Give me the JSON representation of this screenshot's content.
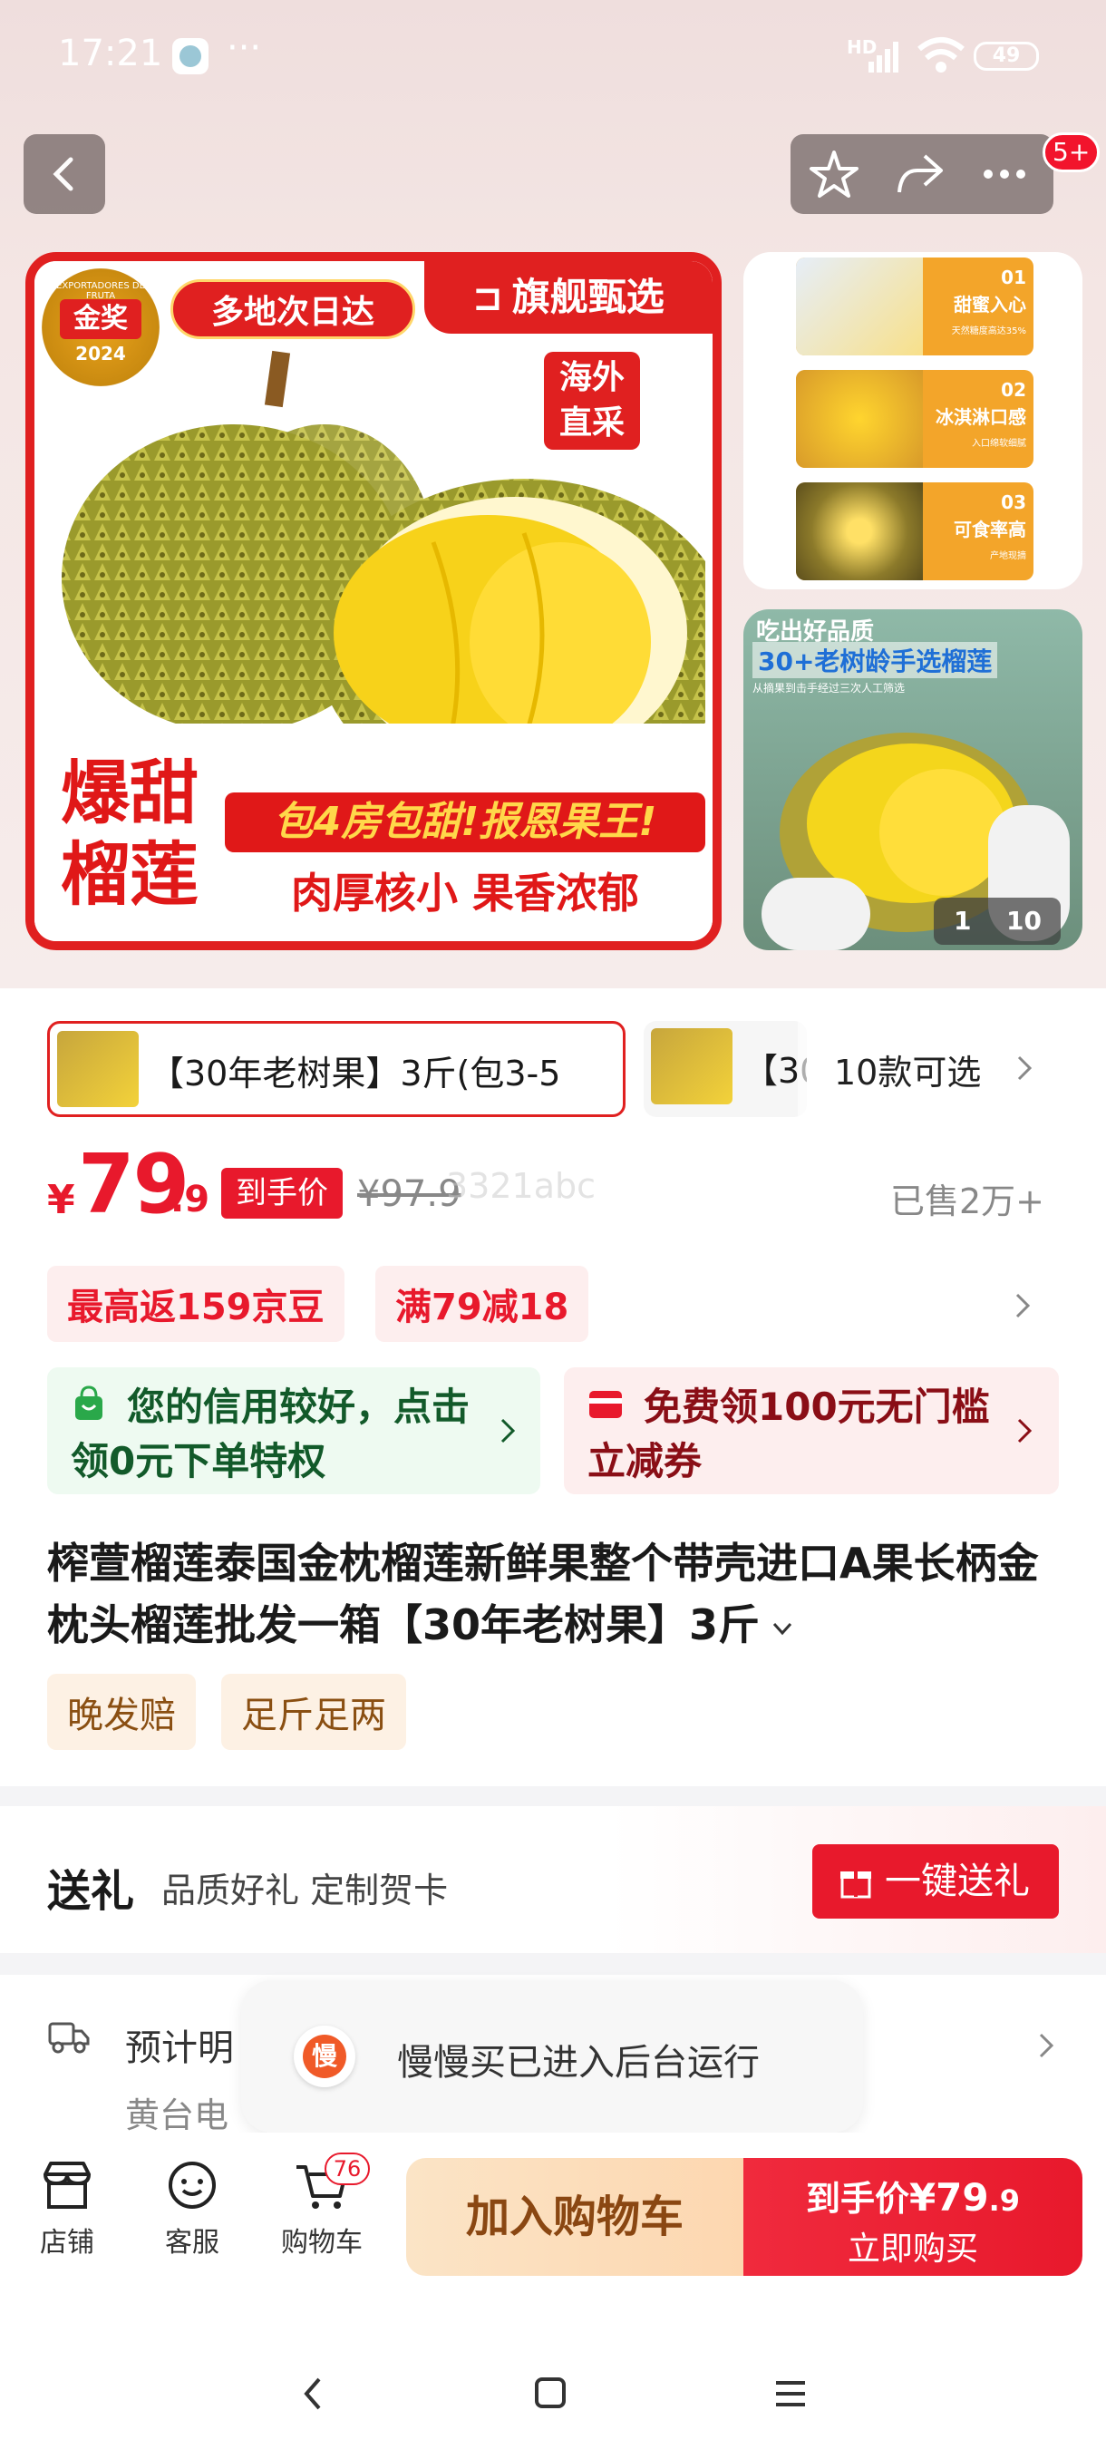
{
  "status_bar": {
    "time": "17:21",
    "more": "···",
    "hd": "HD",
    "battery": "49"
  },
  "top_nav": {
    "cart_badge": "5+"
  },
  "hero": {
    "award": "金奖",
    "award_year": "2024",
    "award_ring": "EXPORTADORES DE FRUTA",
    "delivery": "多地次日达",
    "flagship": "旗舰甄选",
    "overseas": "海外\n直采",
    "title_main": "爆甜\n榴莲",
    "slogan1": "包4房包甜!报恩果王!",
    "slogan2": "肉厚核小 果香浓郁"
  },
  "thumbs": [
    {
      "num": "01",
      "label": "甜蜜入心",
      "sub": "天然糖度高达35%"
    },
    {
      "num": "02",
      "label": "冰淇淋口感",
      "sub": "入口绵软细腻"
    },
    {
      "num": "03",
      "label": "可食率高",
      "sub": "产地现摘"
    }
  ],
  "second_image": {
    "top_text": "吃出好品质",
    "headline": "30+老树龄手选榴莲",
    "sub": "从摘果到击手经过三次人工筛选",
    "pager_current": "1",
    "pager_total": "10"
  },
  "variants": {
    "selected": "【30年老树果】3斤(包3-5",
    "next": "【30",
    "count_label": "10款可选"
  },
  "price": {
    "currency": "¥",
    "integer": "79",
    "decimal": ".9",
    "tag": "到手价",
    "original": "¥97.9",
    "watermark": "3321abc",
    "sold": "已售2万+"
  },
  "promos": {
    "jingdou": "最高返159京豆",
    "discount": "满79减18"
  },
  "credit": {
    "text": "您的信用较好，点击领0元下单特权",
    "coupon": "免费领100元无门槛立减券"
  },
  "product": {
    "title": "榨萱榴莲泰国金枕榴莲新鲜果整个带壳进口A果长柄金枕头榴莲批发一箱【30年老树果】3斤",
    "tags": [
      "晚发赔",
      "足斤足两"
    ]
  },
  "gift": {
    "title": "送礼",
    "desc": "品质好礼 定制贺卡",
    "button": "一键送礼"
  },
  "delivery": {
    "line1": "预计明",
    "line2": "黄台电"
  },
  "toast": {
    "text": "慢慢买已进入后台运行",
    "app_icon": "慢"
  },
  "bottom_bar": {
    "shop": "店铺",
    "service": "客服",
    "cart": "购物车",
    "cart_count": "76",
    "add_to_cart": "加入购物车",
    "buy_price_label": "到手价",
    "buy_price": "¥79",
    "buy_price_dec": ".9",
    "buy_now": "立即购买"
  }
}
